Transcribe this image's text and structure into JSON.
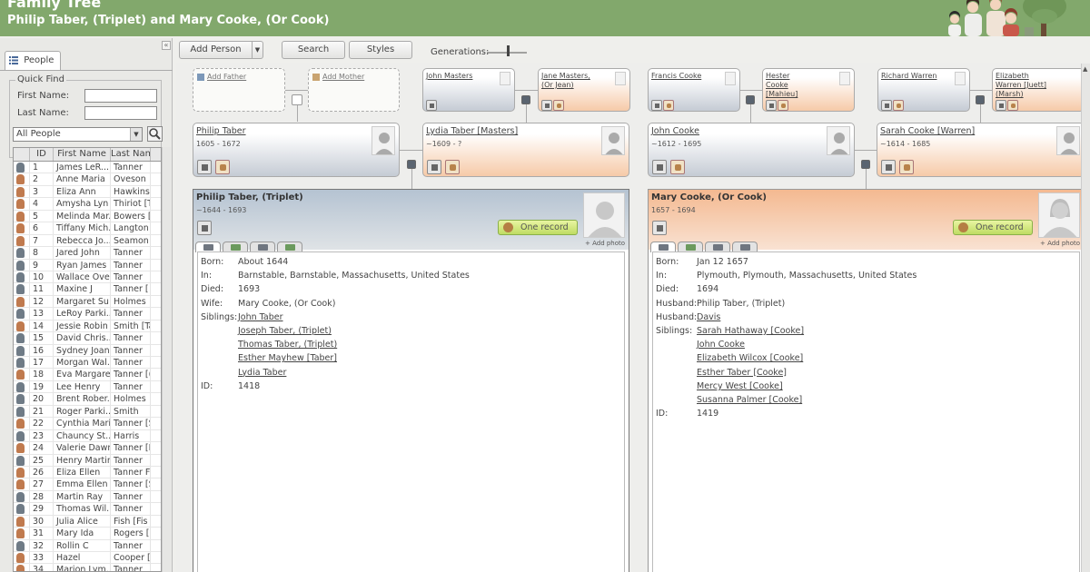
{
  "app": {
    "title": "Family Tree",
    "subtitle": "Philip Taber, (Triplet) and Mary Cooke, (Or Cook)"
  },
  "left": {
    "tab_label": "People",
    "collapse": "«",
    "quick_find": {
      "legend": "Quick Find",
      "first_label": "First Name:",
      "last_label": "Last Name:",
      "first_value": "",
      "last_value": ""
    },
    "filter": "All People",
    "columns": {
      "id": "ID",
      "first": "First Name",
      "last": "Last Name"
    },
    "rows": [
      {
        "g": "m",
        "id": "1",
        "first": "James LeR...",
        "last": "Tanner"
      },
      {
        "g": "f",
        "id": "2",
        "first": "Anne Maria",
        "last": "Oveson"
      },
      {
        "g": "f",
        "id": "3",
        "first": "Eliza Ann",
        "last": "Hawkins"
      },
      {
        "g": "f",
        "id": "4",
        "first": "Amysha Lyn",
        "last": "Thiriot [T"
      },
      {
        "g": "f",
        "id": "5",
        "first": "Melinda Mar...",
        "last": "Bowers ["
      },
      {
        "g": "f",
        "id": "6",
        "first": "Tiffany Mich...",
        "last": "Langton"
      },
      {
        "g": "f",
        "id": "7",
        "first": "Rebecca Jo...",
        "last": "Seamon"
      },
      {
        "g": "m",
        "id": "8",
        "first": "Jared John",
        "last": "Tanner"
      },
      {
        "g": "m",
        "id": "9",
        "first": "Ryan James",
        "last": "Tanner"
      },
      {
        "g": "m",
        "id": "10",
        "first": "Wallace Ove",
        "last": "Tanner"
      },
      {
        "g": "m",
        "id": "11",
        "first": "Maxine J",
        "last": "Tanner ["
      },
      {
        "g": "f",
        "id": "12",
        "first": "Margaret Su...",
        "last": "Holmes"
      },
      {
        "g": "m",
        "id": "13",
        "first": "LeRoy Parki...",
        "last": "Tanner"
      },
      {
        "g": "f",
        "id": "14",
        "first": "Jessie Robin",
        "last": "Smith [Ta"
      },
      {
        "g": "m",
        "id": "15",
        "first": "David Chris...",
        "last": "Tanner"
      },
      {
        "g": "m",
        "id": "16",
        "first": "Sydney Joan",
        "last": "Tanner"
      },
      {
        "g": "m",
        "id": "17",
        "first": "Morgan Wal...",
        "last": "Tanner"
      },
      {
        "g": "f",
        "id": "18",
        "first": "Eva Margaret",
        "last": "Tanner [("
      },
      {
        "g": "m",
        "id": "19",
        "first": "Lee Henry",
        "last": "Tanner"
      },
      {
        "g": "m",
        "id": "20",
        "first": "Brent Rober...",
        "last": "Holmes"
      },
      {
        "g": "m",
        "id": "21",
        "first": "Roger Parki...",
        "last": "Smith"
      },
      {
        "g": "f",
        "id": "22",
        "first": "Cynthia Marie",
        "last": "Tanner [S"
      },
      {
        "g": "m",
        "id": "23",
        "first": "Chauncy St...",
        "last": "Harris"
      },
      {
        "g": "f",
        "id": "24",
        "first": "Valerie Dawn",
        "last": "Tanner [L"
      },
      {
        "g": "m",
        "id": "25",
        "first": "Henry Martin",
        "last": "Tanner"
      },
      {
        "g": "f",
        "id": "26",
        "first": "Eliza Ellen",
        "last": "Tanner F"
      },
      {
        "g": "f",
        "id": "27",
        "first": "Emma Ellen",
        "last": "Tanner [S"
      },
      {
        "g": "m",
        "id": "28",
        "first": "Martin Ray",
        "last": "Tanner"
      },
      {
        "g": "m",
        "id": "29",
        "first": "Thomas Wil...",
        "last": "Tanner"
      },
      {
        "g": "f",
        "id": "30",
        "first": "Julia Alice",
        "last": "Fish [Fis"
      },
      {
        "g": "f",
        "id": "31",
        "first": "Mary Ida",
        "last": "Rogers ["
      },
      {
        "g": "m",
        "id": "32",
        "first": "Rollin C",
        "last": "Tanner"
      },
      {
        "g": "f",
        "id": "33",
        "first": "Hazel",
        "last": "Cooper ["
      },
      {
        "g": "f",
        "id": "34",
        "first": "Marion Lym...",
        "last": "Tanner"
      }
    ]
  },
  "toolbar": {
    "add_person": "Add Person",
    "search": "Search",
    "styles": "Styles",
    "generations": "Generations:"
  },
  "tree": {
    "add_father": "Add Father",
    "add_mother": "Add Mother",
    "gp": [
      {
        "name": "John Masters",
        "gender": "male"
      },
      {
        "name": "Jane Masters, (Or Jean)",
        "gender": "female"
      },
      {
        "name": "Francis Cooke",
        "gender": "male"
      },
      {
        "name": "Hester Cooke [Mahieu]",
        "gender": "female"
      },
      {
        "name": "Richard Warren",
        "gender": "male"
      },
      {
        "name": "Elizabeth Warren [Juett] (Marsh)",
        "gender": "female"
      }
    ],
    "parents": [
      {
        "name": "Philip Taber",
        "dates": "1605 - 1672",
        "gender": "male"
      },
      {
        "name": "Lydia Taber [Masters]",
        "dates": "~1609 - ?",
        "gender": "female"
      },
      {
        "name": "John Cooke",
        "dates": "~1612 - 1695",
        "gender": "male"
      },
      {
        "name": "Sarah Cooke [Warren]",
        "dates": "~1614 - 1685",
        "gender": "female"
      }
    ]
  },
  "husband": {
    "name": "Philip Taber, (Triplet)",
    "dates": "~1644 - 1693",
    "records": "One record",
    "add_photo": "+ Add photo",
    "facts": [
      {
        "label": "Born:",
        "value": "About 1644"
      },
      {
        "label": "In:",
        "value": "Barnstable, Barnstable, Massachusetts, United States"
      },
      {
        "label": "Died:",
        "value": "1693"
      },
      {
        "label": "Wife:",
        "value": "Mary Cooke, (Or Cook)"
      }
    ],
    "siblings_label": "Siblings:",
    "siblings": [
      "John Taber",
      "Joseph Taber, (Triplet)",
      "Thomas Taber, (Triplet)",
      "Esther Mayhew [Taber]",
      "Lydia Taber"
    ],
    "id_label": "ID:",
    "id": "1418"
  },
  "wife": {
    "name": "Mary Cooke, (Or Cook)",
    "dates": "1657 - 1694",
    "records": "One record",
    "add_photo": "+ Add photo",
    "facts": [
      {
        "label": "Born:",
        "value": "Jan 12 1657"
      },
      {
        "label": "In:",
        "value": "Plymouth, Plymouth, Massachusetts, United States"
      },
      {
        "label": "Died:",
        "value": "1694"
      },
      {
        "label": "Husband:",
        "value": "Philip Taber, (Triplet)"
      }
    ],
    "husband2_label": "Husband:",
    "husband2": "Davis",
    "siblings_label": "Siblings:",
    "siblings": [
      "Sarah Hathaway [Cooke]",
      "John Cooke",
      "Elizabeth Wilcox [Cooke]",
      "Esther Taber [Cooke]",
      "Mercy West [Cooke]",
      "Susanna Palmer [Cooke]"
    ],
    "id_label": "ID:",
    "id": "1419"
  },
  "colors": {
    "header": "#82a86c",
    "male": "#c5cbd4",
    "female": "#f6caa8",
    "record": "#bfdc63"
  }
}
